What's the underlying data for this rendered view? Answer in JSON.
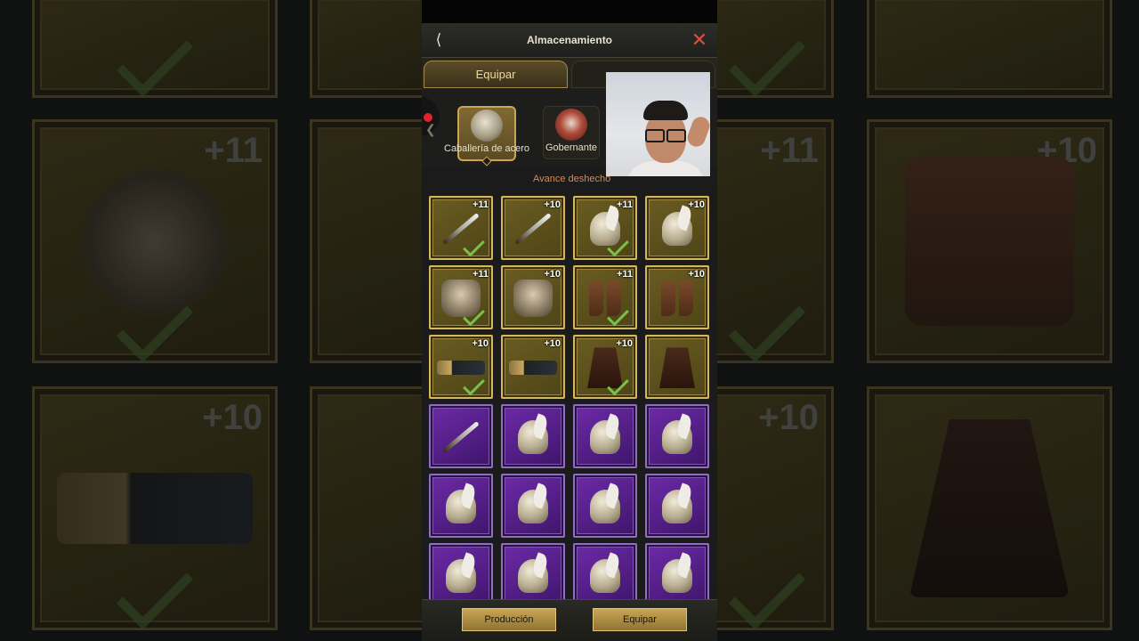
{
  "header": {
    "title": "Almacenamiento"
  },
  "tabs": [
    {
      "label": "Equipar"
    },
    {
      "label": ""
    }
  ],
  "heroes": [
    {
      "name": "Caballería de acero"
    },
    {
      "name": "Gobernante"
    }
  ],
  "subtitle": "Avance deshecho",
  "grid": [
    {
      "type": "weapon",
      "level": "+11",
      "equipped": true,
      "rarity": "gold"
    },
    {
      "type": "weapon",
      "level": "+10",
      "equipped": false,
      "rarity": "gold"
    },
    {
      "type": "helmet",
      "level": "+11",
      "equipped": true,
      "rarity": "gold"
    },
    {
      "type": "helmet",
      "level": "+10",
      "equipped": false,
      "rarity": "gold"
    },
    {
      "type": "armor",
      "level": "+11",
      "equipped": true,
      "rarity": "gold"
    },
    {
      "type": "armor",
      "level": "+10",
      "equipped": false,
      "rarity": "gold"
    },
    {
      "type": "boots",
      "level": "+11",
      "equipped": true,
      "rarity": "gold"
    },
    {
      "type": "boots",
      "level": "+10",
      "equipped": false,
      "rarity": "gold"
    },
    {
      "type": "belt",
      "level": "+10",
      "equipped": true,
      "rarity": "gold"
    },
    {
      "type": "belt",
      "level": "+10",
      "equipped": false,
      "rarity": "gold"
    },
    {
      "type": "cape",
      "level": "+10",
      "equipped": true,
      "rarity": "gold"
    },
    {
      "type": "cape",
      "level": "",
      "equipped": false,
      "rarity": "gold"
    },
    {
      "type": "weapon",
      "level": "",
      "equipped": false,
      "rarity": "purple"
    },
    {
      "type": "helmet",
      "level": "",
      "equipped": false,
      "rarity": "purple"
    },
    {
      "type": "helmet",
      "level": "",
      "equipped": false,
      "rarity": "purple"
    },
    {
      "type": "helmet",
      "level": "",
      "equipped": false,
      "rarity": "purple"
    },
    {
      "type": "helmet",
      "level": "",
      "equipped": false,
      "rarity": "purple"
    },
    {
      "type": "helmet",
      "level": "",
      "equipped": false,
      "rarity": "purple"
    },
    {
      "type": "helmet",
      "level": "",
      "equipped": false,
      "rarity": "purple"
    },
    {
      "type": "helmet",
      "level": "",
      "equipped": false,
      "rarity": "purple"
    },
    {
      "type": "helmet",
      "level": "",
      "equipped": false,
      "rarity": "purple"
    },
    {
      "type": "helmet",
      "level": "",
      "equipped": false,
      "rarity": "purple"
    },
    {
      "type": "helmet",
      "level": "",
      "equipped": false,
      "rarity": "purple"
    },
    {
      "type": "helmet",
      "level": "",
      "equipped": false,
      "rarity": "purple"
    }
  ],
  "buttons": {
    "produce": "Producción",
    "equip": "Equipar"
  },
  "background": {
    "left_levels": [
      "+11",
      "+10"
    ],
    "right_levels": [
      "+11",
      "+10",
      "+10"
    ]
  },
  "colors": {
    "gold_border": "#d6b85a",
    "purple_slot": "#6e2aa8",
    "close": "#d9523a",
    "check": "#7ac04a"
  }
}
